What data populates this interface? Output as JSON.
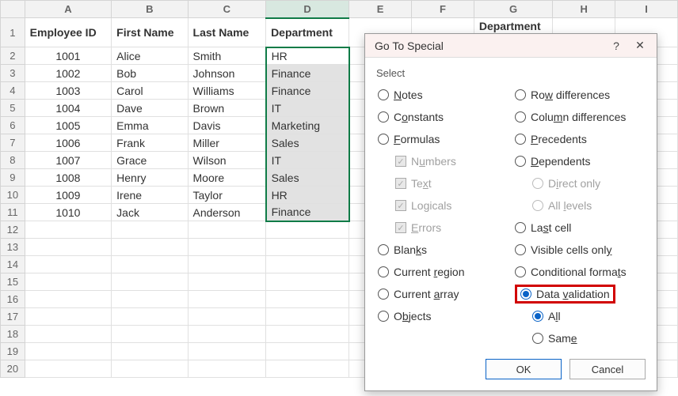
{
  "columns": [
    "A",
    "B",
    "C",
    "D",
    "E",
    "F",
    "G",
    "H",
    "I"
  ],
  "headers": {
    "A": "Employee ID",
    "B": "First Name",
    "C": "Last Name",
    "D": "Department",
    "G": "Department List"
  },
  "rows": [
    {
      "id": "1001",
      "first": "Alice",
      "last": "Smith",
      "dept": "HR"
    },
    {
      "id": "1002",
      "first": "Bob",
      "last": "Johnson",
      "dept": "Finance"
    },
    {
      "id": "1003",
      "first": "Carol",
      "last": "Williams",
      "dept": "Finance"
    },
    {
      "id": "1004",
      "first": "Dave",
      "last": "Brown",
      "dept": "IT"
    },
    {
      "id": "1005",
      "first": "Emma",
      "last": "Davis",
      "dept": "Marketing"
    },
    {
      "id": "1006",
      "first": "Frank",
      "last": "Miller",
      "dept": "Sales"
    },
    {
      "id": "1007",
      "first": "Grace",
      "last": "Wilson",
      "dept": "IT"
    },
    {
      "id": "1008",
      "first": "Henry",
      "last": "Moore",
      "dept": "Sales"
    },
    {
      "id": "1009",
      "first": "Irene",
      "last": "Taylor",
      "dept": "HR"
    },
    {
      "id": "1010",
      "first": "Jack",
      "last": "Anderson",
      "dept": "Finance"
    }
  ],
  "row_count": 20,
  "dialog": {
    "title": "Go To Special",
    "help": "?",
    "close": "✕",
    "section": "Select",
    "left": {
      "notes": "Notes",
      "constants": "Constants",
      "formulas": "Formulas",
      "numbers": "Numbers",
      "text": "Text",
      "logicals": "Logicals",
      "errors": "Errors",
      "blanks": "Blanks",
      "current_region": "Current region",
      "current_array": "Current array",
      "objects": "Objects"
    },
    "right": {
      "row_diff": "Row differences",
      "col_diff": "Column differences",
      "precedents": "Precedents",
      "dependents": "Dependents",
      "direct": "Direct only",
      "all_levels": "All levels",
      "last_cell": "Last cell",
      "visible": "Visible cells only",
      "cond_fmt": "Conditional formats",
      "data_val": "Data validation",
      "all": "All",
      "same": "Same"
    },
    "ok": "OK",
    "cancel": "Cancel"
  }
}
